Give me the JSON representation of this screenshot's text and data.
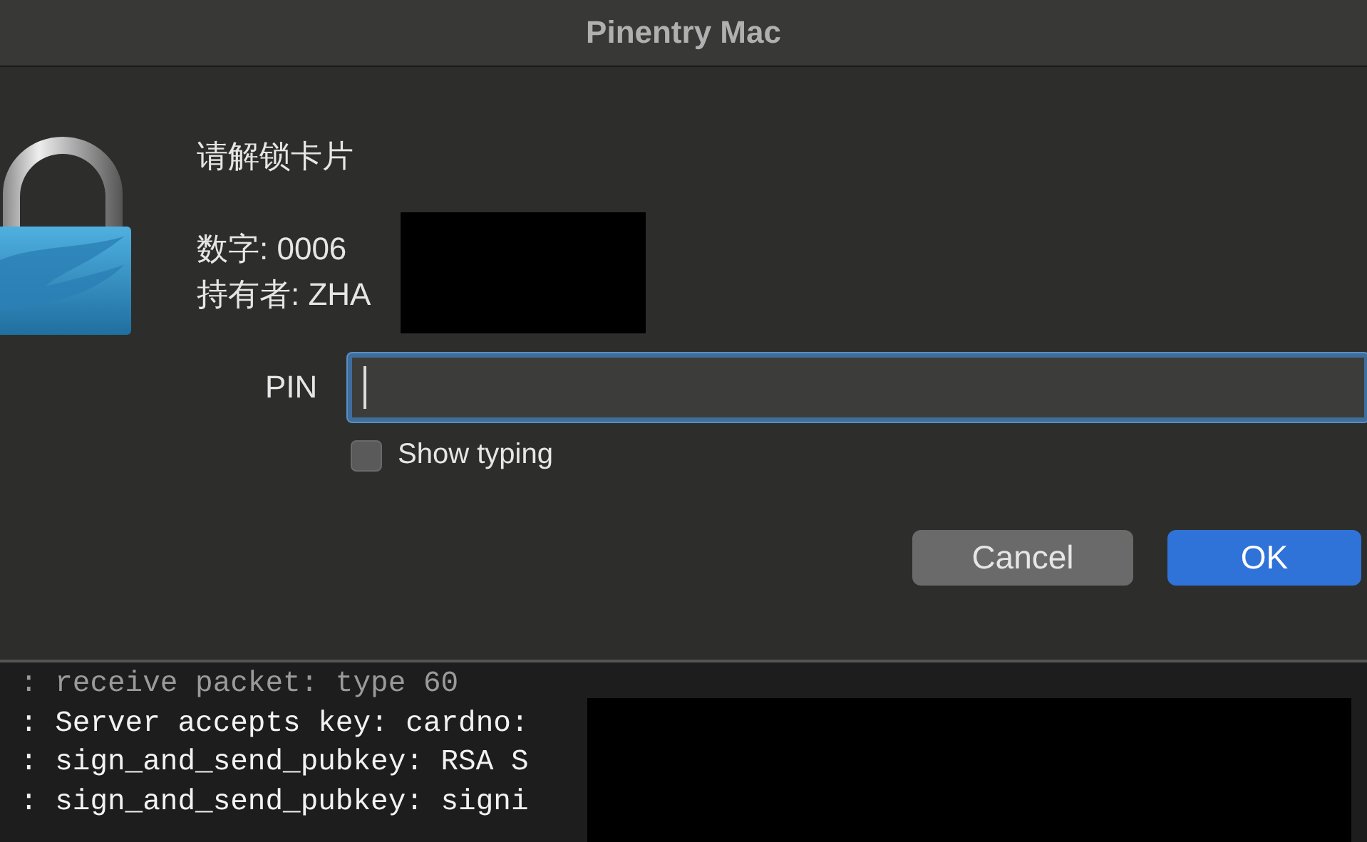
{
  "window": {
    "title": "Pinentry Mac"
  },
  "dialog": {
    "heading": "请解锁卡片",
    "details": [
      "数字: 0006",
      "持有者: ZHA"
    ],
    "pin": {
      "label": "PIN",
      "focused": true
    },
    "show_typing": {
      "label": "Show typing",
      "checked": false
    },
    "buttons": [
      {
        "label": "Cancel",
        "kind": "secondary"
      },
      {
        "label": "OK",
        "kind": "default"
      }
    ]
  },
  "terminal": {
    "lines": [
      {
        "text": ": receive packet: type 60",
        "dimmed": true
      },
      {
        "text": ": Server accepts key: cardno:",
        "dimmed": false
      },
      {
        "text": ": sign_and_send_pubkey: RSA S",
        "dimmed": false
      },
      {
        "text": ": sign_and_send_pubkey: signi",
        "dimmed": false
      }
    ]
  }
}
